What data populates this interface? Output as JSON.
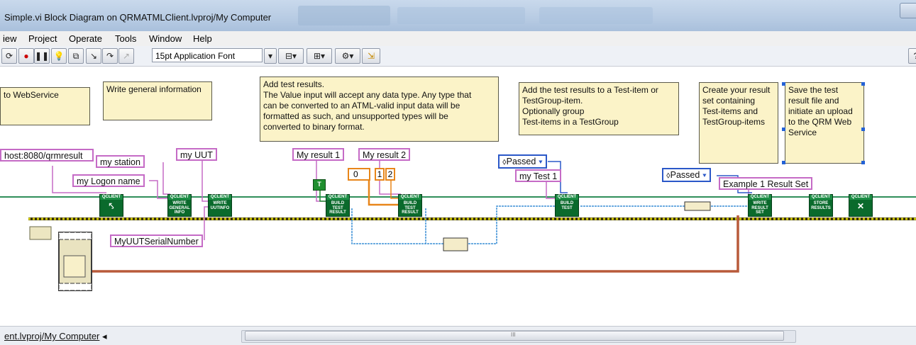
{
  "window": {
    "title": "Simple.vi Block Diagram on QRMATMLClient.lvproj/My Computer"
  },
  "menu": [
    "iew",
    "Project",
    "Operate",
    "Tools",
    "Window",
    "Help"
  ],
  "toolbar": {
    "font": "15pt Application Font"
  },
  "comments": {
    "webservice": "to WebService",
    "general": "Write general information",
    "results": "Add test results.\nThe Value input will accept any data type. Any type that\ncan be converted to an ATML-valid input data will be\nformatted as such, and unsupported types will be\nconverted to binary format.",
    "test_item": "Add the test results to a Test-item or\nTestGroup-item.\nOptionally group\nTest-items in a TestGroup",
    "result_set": "Create your result\nset containing\nTest-items and\nTestGroup-items",
    "upload": "Save the test\nresult file and\ninitiate an upload\nto the QRM Web\nService"
  },
  "constants": {
    "url": "host:8080/qrmresult",
    "station": "my station",
    "logon": "my Logon name",
    "uut": "my UUT",
    "serial": "MyUUTSerialNumber",
    "result1": "My result 1",
    "result2": "My result 2",
    "num0": "0",
    "num1": "1",
    "num2": "2",
    "test1": "my Test 1",
    "result_set": "Example 1 Result Set",
    "passed1": "Passed",
    "passed2": "Passed",
    "bool": "T"
  },
  "nodes": {
    "client_open": {
      "hdr": "QCLIENT",
      "label": ""
    },
    "general_info": {
      "hdr": "QCLIENT",
      "label": "WRITE GENERAL INFO"
    },
    "uut_info": {
      "hdr": "QCLIENT",
      "label": "WRITE UUTINFO"
    },
    "build_result1": {
      "hdr": "QCLIENT",
      "label": "BUILD TEST RESULT"
    },
    "build_result2": {
      "hdr": "QCLIENT",
      "label": "BUILD TEST RESULT"
    },
    "build_test": {
      "hdr": "QCLIENT",
      "label": "BUILD TEST"
    },
    "result_set": {
      "hdr": "QCLIENT",
      "label": "WRITE RESULT SET"
    },
    "store": {
      "hdr": "QCLIENT",
      "label": "STORE RESULTS"
    },
    "client_close": {
      "hdr": "QCLIENT",
      "label": ""
    }
  },
  "status": {
    "path": "ent.lvproj/My Computer",
    "scroll": "III"
  },
  "colors": {
    "class_wire": "#2f8f5a",
    "error_wire": "#b8b200",
    "string_wire": "#c56bc6",
    "enum_wire": "#2b58c8",
    "ref_wire": "#b85a3a"
  }
}
